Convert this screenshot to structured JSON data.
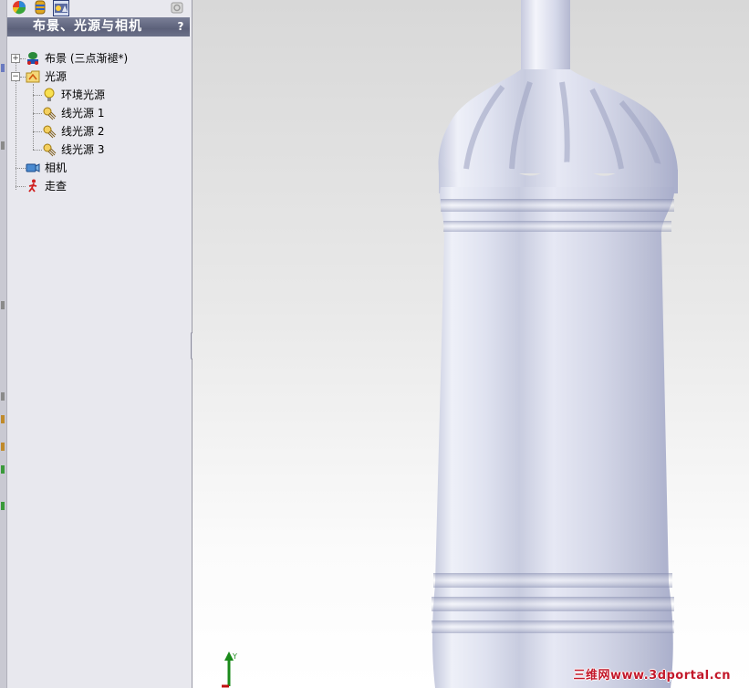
{
  "panel": {
    "title": "布景、光源与相机",
    "help_label": "?",
    "toolbar_icons": [
      "appearance-icon",
      "scene-icon",
      "render-tools-icon",
      "configuration-icon"
    ]
  },
  "tree": {
    "scene": {
      "label": "布景 (三点渐褪*)",
      "icon": "scene-icon",
      "expander": "+"
    },
    "lights": {
      "label": "光源",
      "icon": "lights-folder-icon",
      "expander": "−"
    },
    "ambient": {
      "label": "环境光源",
      "icon": "bulb-icon"
    },
    "directional_1": {
      "label": "线光源 1",
      "icon": "directional-light-icon"
    },
    "directional_2": {
      "label": "线光源 2",
      "icon": "directional-light-icon"
    },
    "directional_3": {
      "label": "线光源 3",
      "icon": "directional-light-icon"
    },
    "camera": {
      "label": "相机",
      "icon": "camera-icon"
    },
    "walkthrough": {
      "label": "走查",
      "icon": "walkthrough-icon"
    }
  },
  "viewport": {
    "model": "bottle",
    "triad_label_y": "Y",
    "watermark": "三维网www.3dportal.cn"
  },
  "colors": {
    "title_bar": "#6b7088",
    "panel_bg": "#e8e8ee",
    "watermark": "#c3192b",
    "bottle": "#d8dcee"
  }
}
